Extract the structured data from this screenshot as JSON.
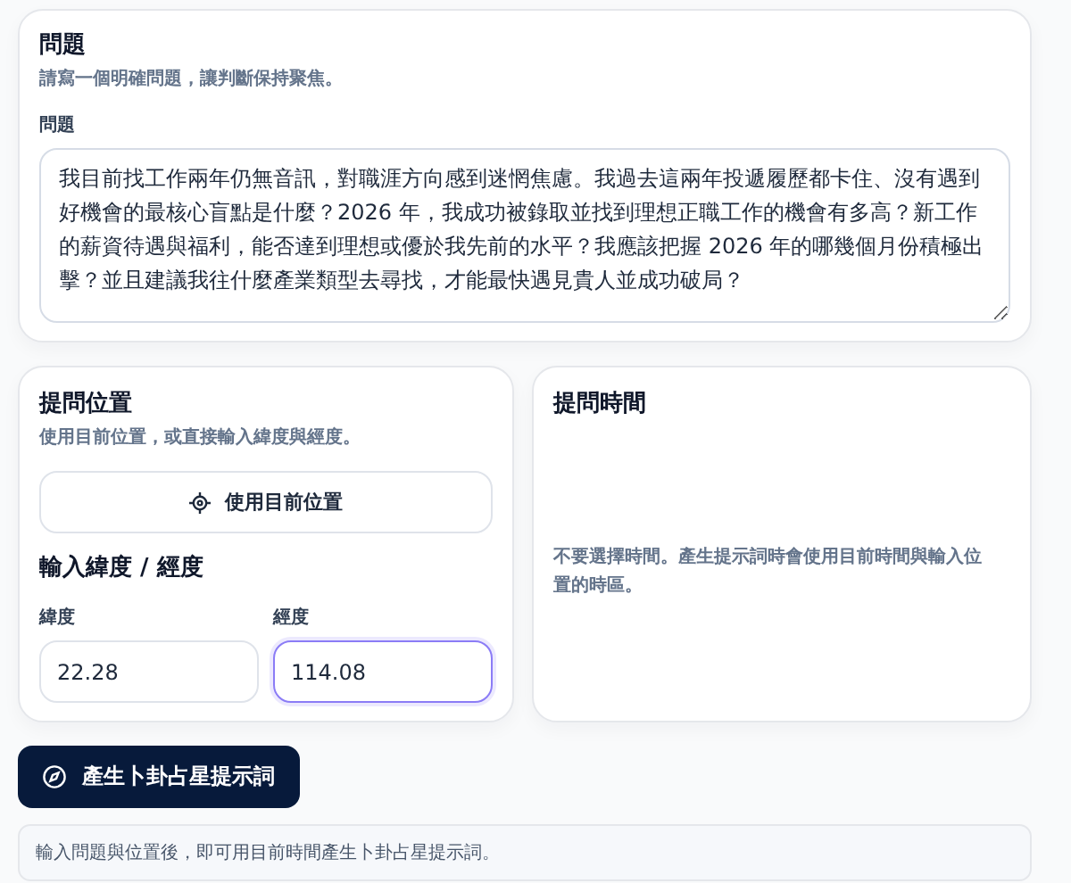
{
  "question_card": {
    "title": "問題",
    "subtitle": "請寫一個明確問題，讓判斷保持聚焦。",
    "field_label": "問題",
    "value": "我目前找工作兩年仍無音訊，對職涯方向感到迷惘焦慮。我過去這兩年投遞履歷都卡住、沒有遇到好機會的最核心盲點是什麼？2026 年，我成功被錄取並找到理想正職工作的機會有多高？新工作的薪資待遇與福利，能否達到理想或優於我先前的水平？我應該把握 2026 年的哪幾個月份積極出擊？並且建議我往什麼產業類型去尋找，才能最快遇見貴人並成功破局？"
  },
  "location_card": {
    "title": "提問位置",
    "subtitle": "使用目前位置，或直接輸入緯度與經度。",
    "locate_button": "使用目前位置",
    "coords_title": "輸入緯度 / 經度",
    "fields": [
      {
        "label": "緯度",
        "value": "22.28",
        "focused": false
      },
      {
        "label": "經度",
        "value": "114.08",
        "focused": true
      }
    ]
  },
  "time_card": {
    "title": "提問時間",
    "note": "不要選擇時間。產生提示詞時會使用目前時間與輸入位置的時區。"
  },
  "generate_button": "產生卜卦占星提示詞",
  "status_note": "輸入問題與位置後，即可用目前時間產生卜卦占星提示詞。"
}
